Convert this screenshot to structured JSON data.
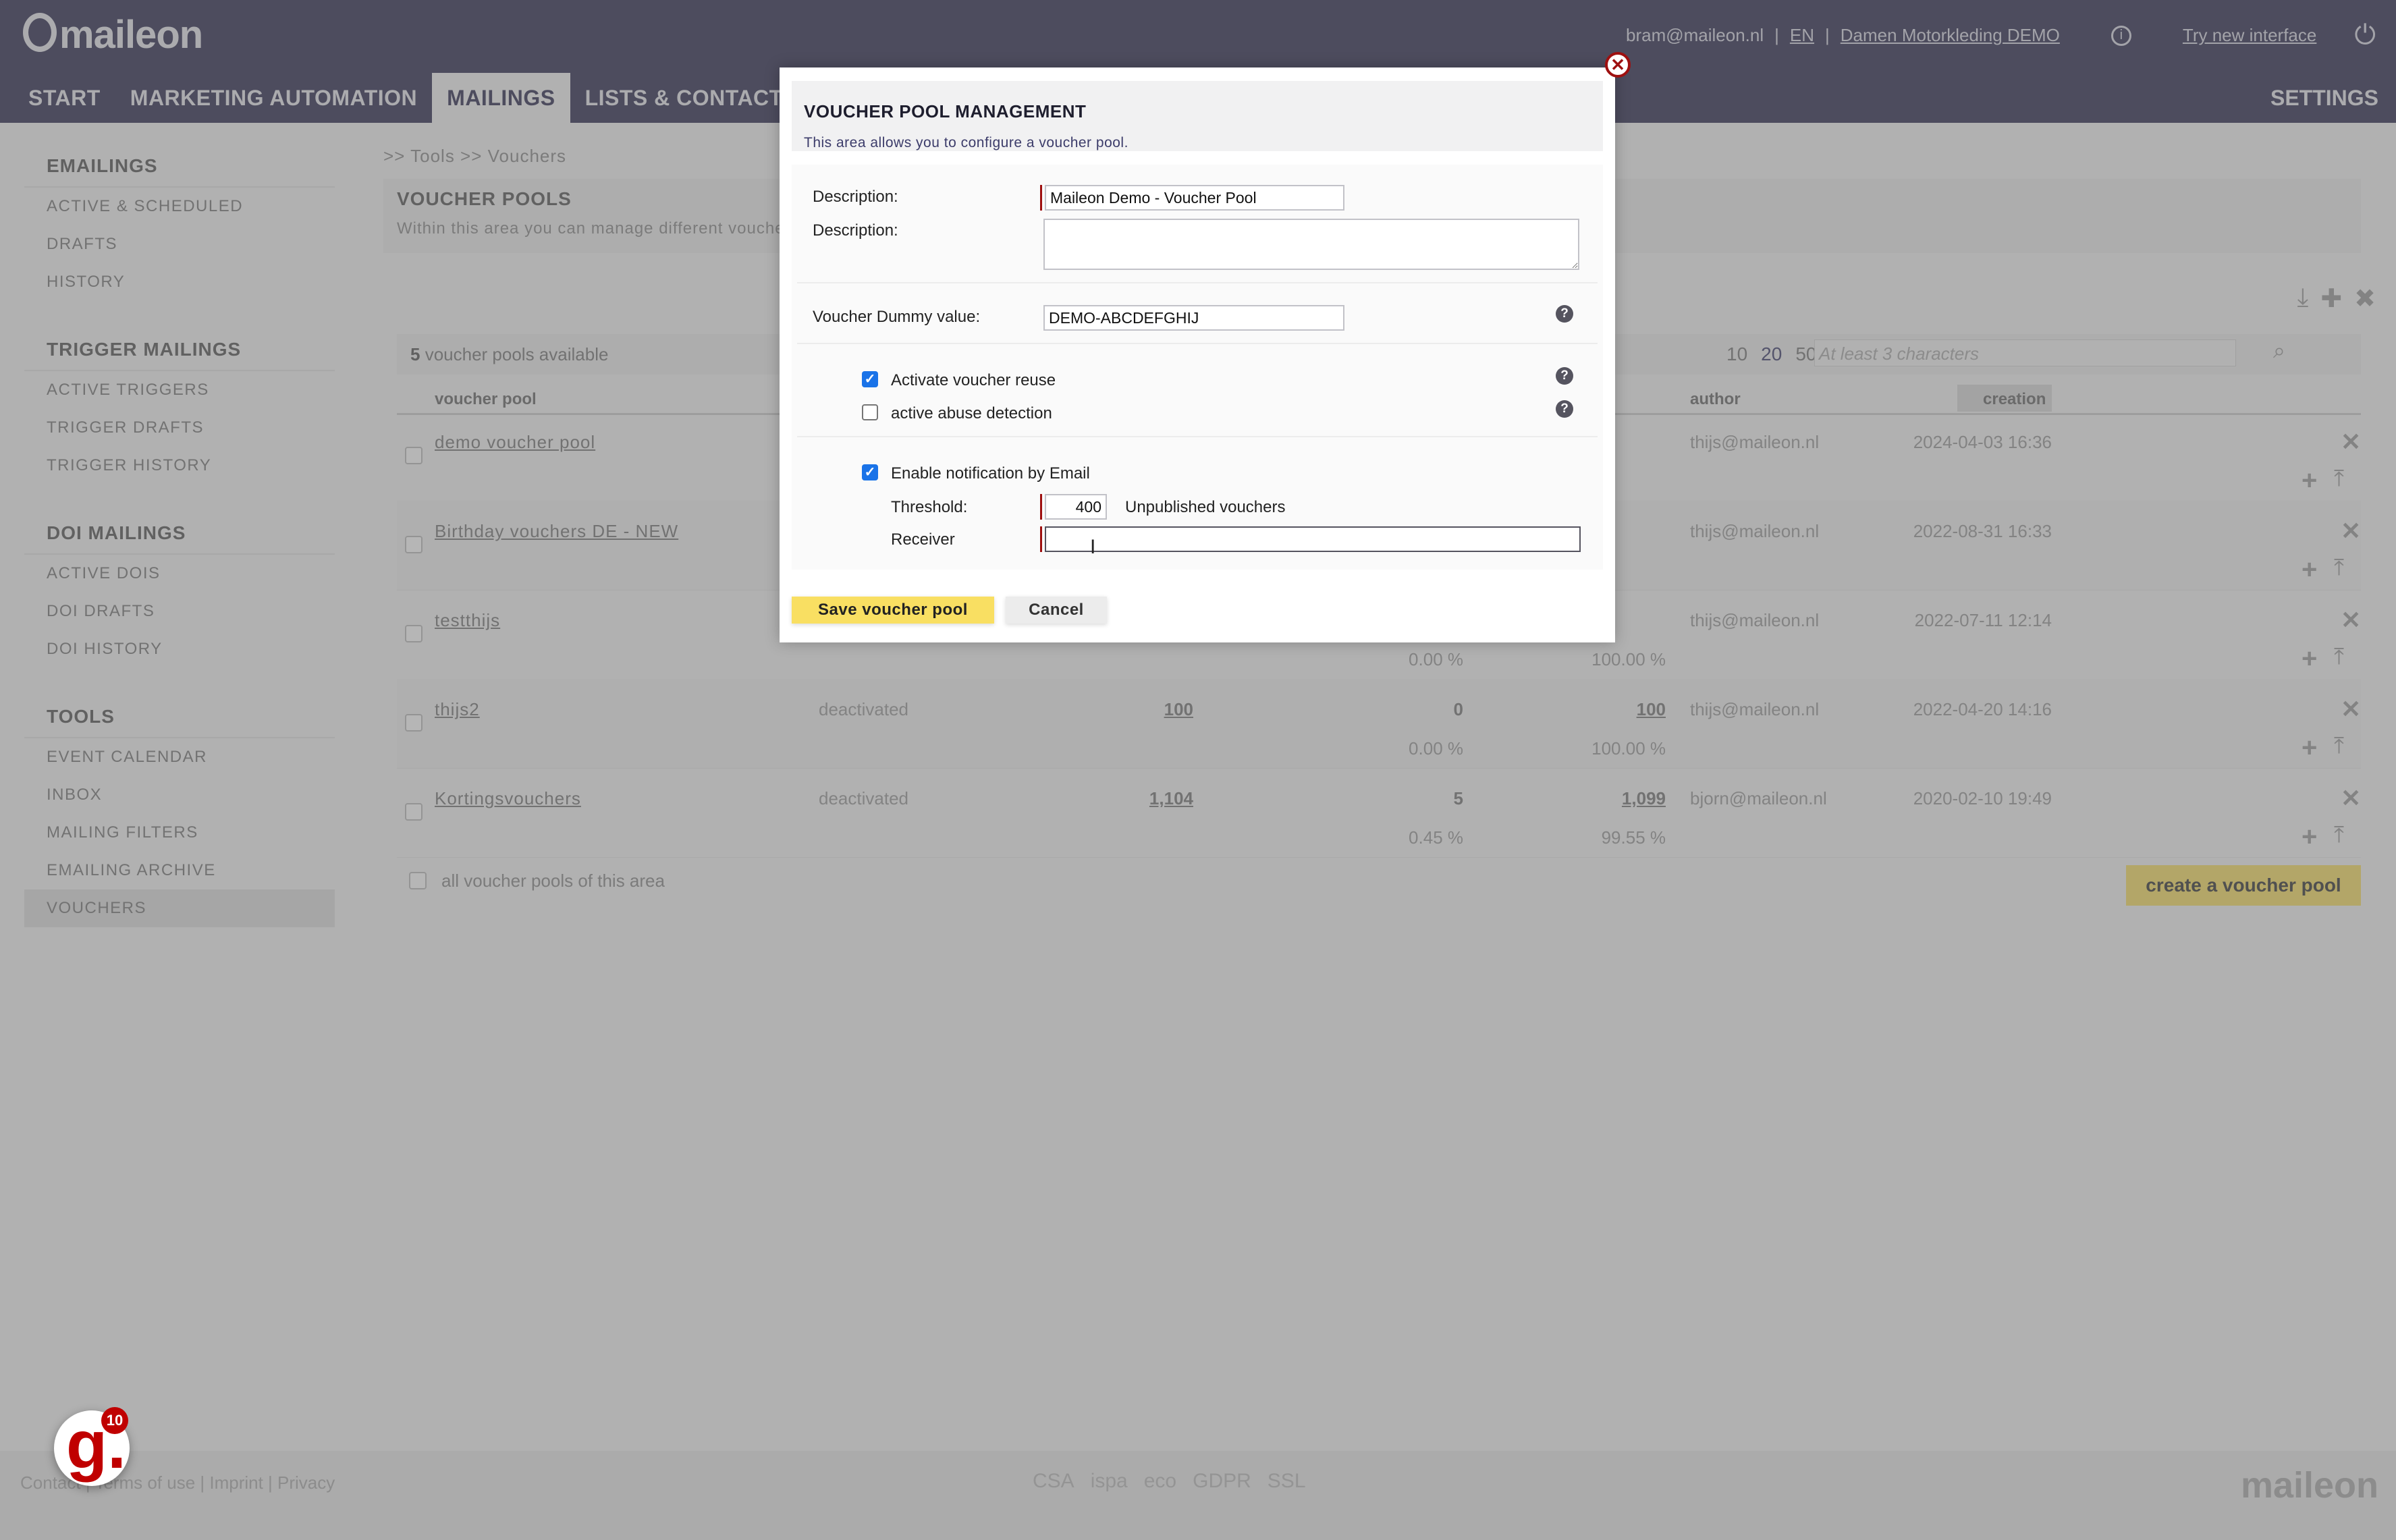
{
  "header": {
    "logo": "maileon",
    "user_email": "bram@maileon.nl",
    "language": "EN",
    "account": "Damen Motorkleding DEMO",
    "try_new": "Try new interface",
    "separator": "|",
    "info_icon": "i",
    "power_icon": "⏻"
  },
  "nav": {
    "tabs": [
      {
        "label": "START"
      },
      {
        "label": "MARKETING AUTOMATION"
      },
      {
        "label": "MAILINGS",
        "active": true
      },
      {
        "label": "LISTS & CONTACTS"
      }
    ],
    "settings": "SETTINGS"
  },
  "sidebar": {
    "sections": [
      {
        "title": "EMAILINGS",
        "items": [
          "ACTIVE & SCHEDULED",
          "DRAFTS",
          "HISTORY"
        ]
      },
      {
        "title": "TRIGGER MAILINGS",
        "items": [
          "ACTIVE TRIGGERS",
          "TRIGGER DRAFTS",
          "TRIGGER HISTORY"
        ]
      },
      {
        "title": "DOI MAILINGS",
        "items": [
          "ACTIVE DOIS",
          "DOI DRAFTS",
          "DOI HISTORY"
        ]
      },
      {
        "title": "TOOLS",
        "items": [
          "EVENT CALENDAR",
          "INBOX",
          "MAILING FILTERS",
          "EMAILING ARCHIVE",
          "VOUCHERS"
        ]
      }
    ],
    "active_item": "VOUCHERS"
  },
  "main": {
    "breadcrumb": ">> Tools   >> Vouchers",
    "title": "VOUCHER POOLS",
    "description": "Within this area you can manage different voucher pools.",
    "count": "5",
    "count_label": "voucher pools available",
    "page_sizes": [
      "10",
      "20",
      "50"
    ],
    "search_placeholder": "At least 3 characters",
    "columns": {
      "pool": "voucher pool",
      "author": "author",
      "creation": "creation"
    },
    "rows": [
      {
        "name": "demo voucher pool",
        "status": "",
        "total": "",
        "published": "",
        "unpublished": "",
        "published_pct": "",
        "unpublished_pct": "",
        "author": "thijs@maileon.nl",
        "creation": "2024-04-03 16:36"
      },
      {
        "name": "Birthday vouchers DE - NEW",
        "status": "",
        "total": "",
        "published": "",
        "unpublished": "",
        "published_pct": "",
        "unpublished_pct": "",
        "author": "thijs@maileon.nl",
        "creation": "2022-08-31 16:33"
      },
      {
        "name": "testthijs",
        "status": "",
        "total": "",
        "published": "",
        "unpublished": "",
        "published_pct": "0.00 %",
        "unpublished_pct": "100.00 %",
        "author": "thijs@maileon.nl",
        "creation": "2022-07-11 12:14"
      },
      {
        "name": "thijs2",
        "status": "deactivated",
        "total": "100",
        "published": "0",
        "unpublished": "100",
        "published_pct": "0.00 %",
        "unpublished_pct": "100.00 %",
        "author": "thijs@maileon.nl",
        "creation": "2022-04-20 14:16"
      },
      {
        "name": "Kortingsvouchers",
        "status": "deactivated",
        "total": "1,104",
        "published": "5",
        "unpublished": "1,099",
        "published_pct": "0.45 %",
        "unpublished_pct": "99.55 %",
        "author": "bjorn@maileon.nl",
        "creation": "2020-02-10 19:49"
      }
    ],
    "select_all_label": "all voucher pools of this area",
    "create_button": "create a voucher pool"
  },
  "footer": {
    "links": "Contact  |  Terms of use  |  Imprint  |  Privacy",
    "certs": [
      "CSA",
      "ispa",
      "eco",
      "GDPR",
      "SSL"
    ],
    "logo": "maileon"
  },
  "widget": {
    "letter": "g.",
    "badge": "10"
  },
  "modal": {
    "title": "VOUCHER POOL MANAGEMENT",
    "subtitle": "This area allows you to configure a voucher pool.",
    "name_label": "Description:",
    "name_value": "Maileon Demo - Voucher Pool",
    "description_label": "Description:",
    "description_value": "",
    "dummy_label": "Voucher Dummy value:",
    "dummy_value": "DEMO-ABCDEFGHIJ",
    "reuse_label": "Activate voucher reuse",
    "reuse_checked": true,
    "abuse_label": "active abuse detection",
    "abuse_checked": false,
    "notify_label": "Enable notification by Email",
    "notify_checked": true,
    "threshold_label": "Threshold:",
    "threshold_value": "400",
    "threshold_suffix": "Unpublished vouchers",
    "receiver_label": "Receiver",
    "receiver_value": "",
    "save_button": "Save voucher pool",
    "cancel_button": "Cancel",
    "close_icon": "✕",
    "help_icon": "?",
    "check_mark": "✓"
  }
}
